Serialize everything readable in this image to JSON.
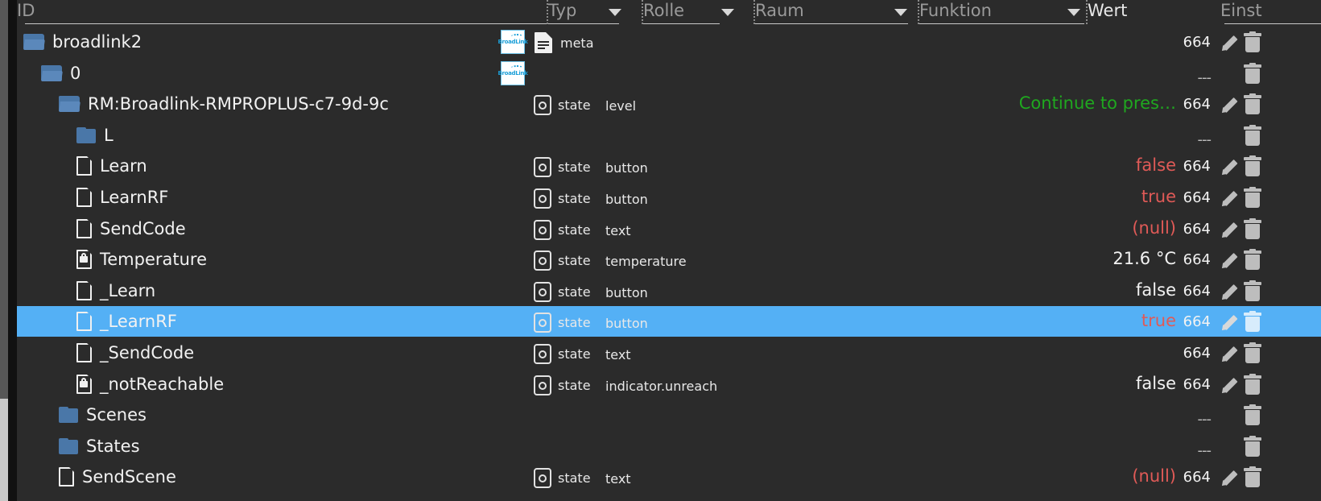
{
  "header": {
    "columns": [
      {
        "label": "ID",
        "filter": false,
        "bright": false
      },
      {
        "label": "Typ",
        "filter": true,
        "bright": false
      },
      {
        "label": "Rolle",
        "filter": true,
        "bright": false
      },
      {
        "label": "Raum",
        "filter": true,
        "bright": false
      },
      {
        "label": "Funktion",
        "filter": true,
        "bright": false
      },
      {
        "label": "Wert",
        "filter": false,
        "bright": true
      },
      {
        "label": "Einst",
        "filter": false,
        "bright": false
      }
    ]
  },
  "colors": {
    "background": "#2b2b2b",
    "selection": "#54b0f5",
    "value_true_false": "#e05a57",
    "value_ok": "#1fa81f",
    "text": "#f2f2f2",
    "folder": "#4a77a8",
    "scrollbar_track": "#575757",
    "scrollbar_thumb": "#c8c8c8"
  },
  "icons": {
    "folder_open": "folder-open-icon",
    "folder_closed": "folder-closed-icon",
    "document": "document-icon",
    "document_locked": "document-lock-icon",
    "meta_document": "meta-document-icon",
    "state": "state-badge-icon",
    "edit": "pencil-icon",
    "delete": "trash-icon",
    "adapter_logo": "broadlink-logo-icon",
    "filter_caret": "chevron-down-icon"
  },
  "logo": {
    "label": "BroadLink"
  },
  "rows": [
    {
      "id": "broadlink2",
      "indent": 0,
      "icon": "folder-open",
      "logo": true,
      "meta": true,
      "meta_label": "meta",
      "state": false,
      "role": "",
      "value": "",
      "value_color": "",
      "num": "664",
      "edit": true,
      "delete": true,
      "selected": false
    },
    {
      "id": "0",
      "indent": 1,
      "icon": "folder-open",
      "logo": true,
      "meta": false,
      "meta_label": "",
      "state": false,
      "role": "",
      "value": "",
      "value_color": "",
      "num": "---",
      "edit": false,
      "delete": true,
      "selected": false
    },
    {
      "id": "RM:Broadlink-RMPROPLUS-c7-9d-9c",
      "indent": 2,
      "icon": "folder-open",
      "logo": false,
      "meta": false,
      "meta_label": "",
      "state": true,
      "role": "level",
      "value": "Continue to pres…",
      "value_color": "#1fa81f",
      "num": "664",
      "edit": true,
      "delete": true,
      "selected": false
    },
    {
      "id": "L",
      "indent": 3,
      "icon": "folder-closed",
      "logo": false,
      "meta": false,
      "meta_label": "",
      "state": false,
      "role": "",
      "value": "",
      "value_color": "",
      "num": "---",
      "edit": false,
      "delete": true,
      "selected": false
    },
    {
      "id": "Learn",
      "indent": 3,
      "icon": "document",
      "logo": false,
      "meta": false,
      "meta_label": "",
      "state": true,
      "role": "button",
      "value": "false",
      "value_color": "#e05a57",
      "num": "664",
      "edit": true,
      "delete": true,
      "selected": false
    },
    {
      "id": "LearnRF",
      "indent": 3,
      "icon": "document",
      "logo": false,
      "meta": false,
      "meta_label": "",
      "state": true,
      "role": "button",
      "value": "true",
      "value_color": "#e05a57",
      "num": "664",
      "edit": true,
      "delete": true,
      "selected": false
    },
    {
      "id": "SendCode",
      "indent": 3,
      "icon": "document",
      "logo": false,
      "meta": false,
      "meta_label": "",
      "state": true,
      "role": "text",
      "value": "(null)",
      "value_color": "#e05a57",
      "num": "664",
      "edit": true,
      "delete": true,
      "selected": false
    },
    {
      "id": "Temperature",
      "indent": 3,
      "icon": "document-locked",
      "logo": false,
      "meta": false,
      "meta_label": "",
      "state": true,
      "role": "temperature",
      "value": "21.6 °C",
      "value_color": "#f2f2f2",
      "num": "664",
      "edit": true,
      "delete": true,
      "selected": false
    },
    {
      "id": "_Learn",
      "indent": 3,
      "icon": "document",
      "logo": false,
      "meta": false,
      "meta_label": "",
      "state": true,
      "role": "button",
      "value": "false",
      "value_color": "#f2f2f2",
      "num": "664",
      "edit": true,
      "delete": true,
      "selected": false
    },
    {
      "id": "_LearnRF",
      "indent": 3,
      "icon": "document",
      "logo": false,
      "meta": false,
      "meta_label": "",
      "state": true,
      "role": "button",
      "value": "true",
      "value_color": "#e05a57",
      "num": "664",
      "edit": true,
      "delete": true,
      "selected": true
    },
    {
      "id": "_SendCode",
      "indent": 3,
      "icon": "document",
      "logo": false,
      "meta": false,
      "meta_label": "",
      "state": true,
      "role": "text",
      "value": "",
      "value_color": "",
      "num": "664",
      "edit": true,
      "delete": true,
      "selected": false
    },
    {
      "id": "_notReachable",
      "indent": 3,
      "icon": "document-locked",
      "logo": false,
      "meta": false,
      "meta_label": "",
      "state": true,
      "role": "indicator.unreach",
      "value": "false",
      "value_color": "#f2f2f2",
      "num": "664",
      "edit": true,
      "delete": true,
      "selected": false
    },
    {
      "id": "Scenes",
      "indent": 2,
      "icon": "folder-closed",
      "logo": false,
      "meta": false,
      "meta_label": "",
      "state": false,
      "role": "",
      "value": "",
      "value_color": "",
      "num": "---",
      "edit": false,
      "delete": true,
      "selected": false
    },
    {
      "id": "States",
      "indent": 2,
      "icon": "folder-closed",
      "logo": false,
      "meta": false,
      "meta_label": "",
      "state": false,
      "role": "",
      "value": "",
      "value_color": "",
      "num": "---",
      "edit": false,
      "delete": true,
      "selected": false
    },
    {
      "id": "SendScene",
      "indent": 2,
      "icon": "document",
      "logo": false,
      "meta": false,
      "meta_label": "",
      "state": true,
      "role": "text",
      "value": "(null)",
      "value_color": "#e05a57",
      "num": "664",
      "edit": true,
      "delete": true,
      "selected": false
    }
  ]
}
